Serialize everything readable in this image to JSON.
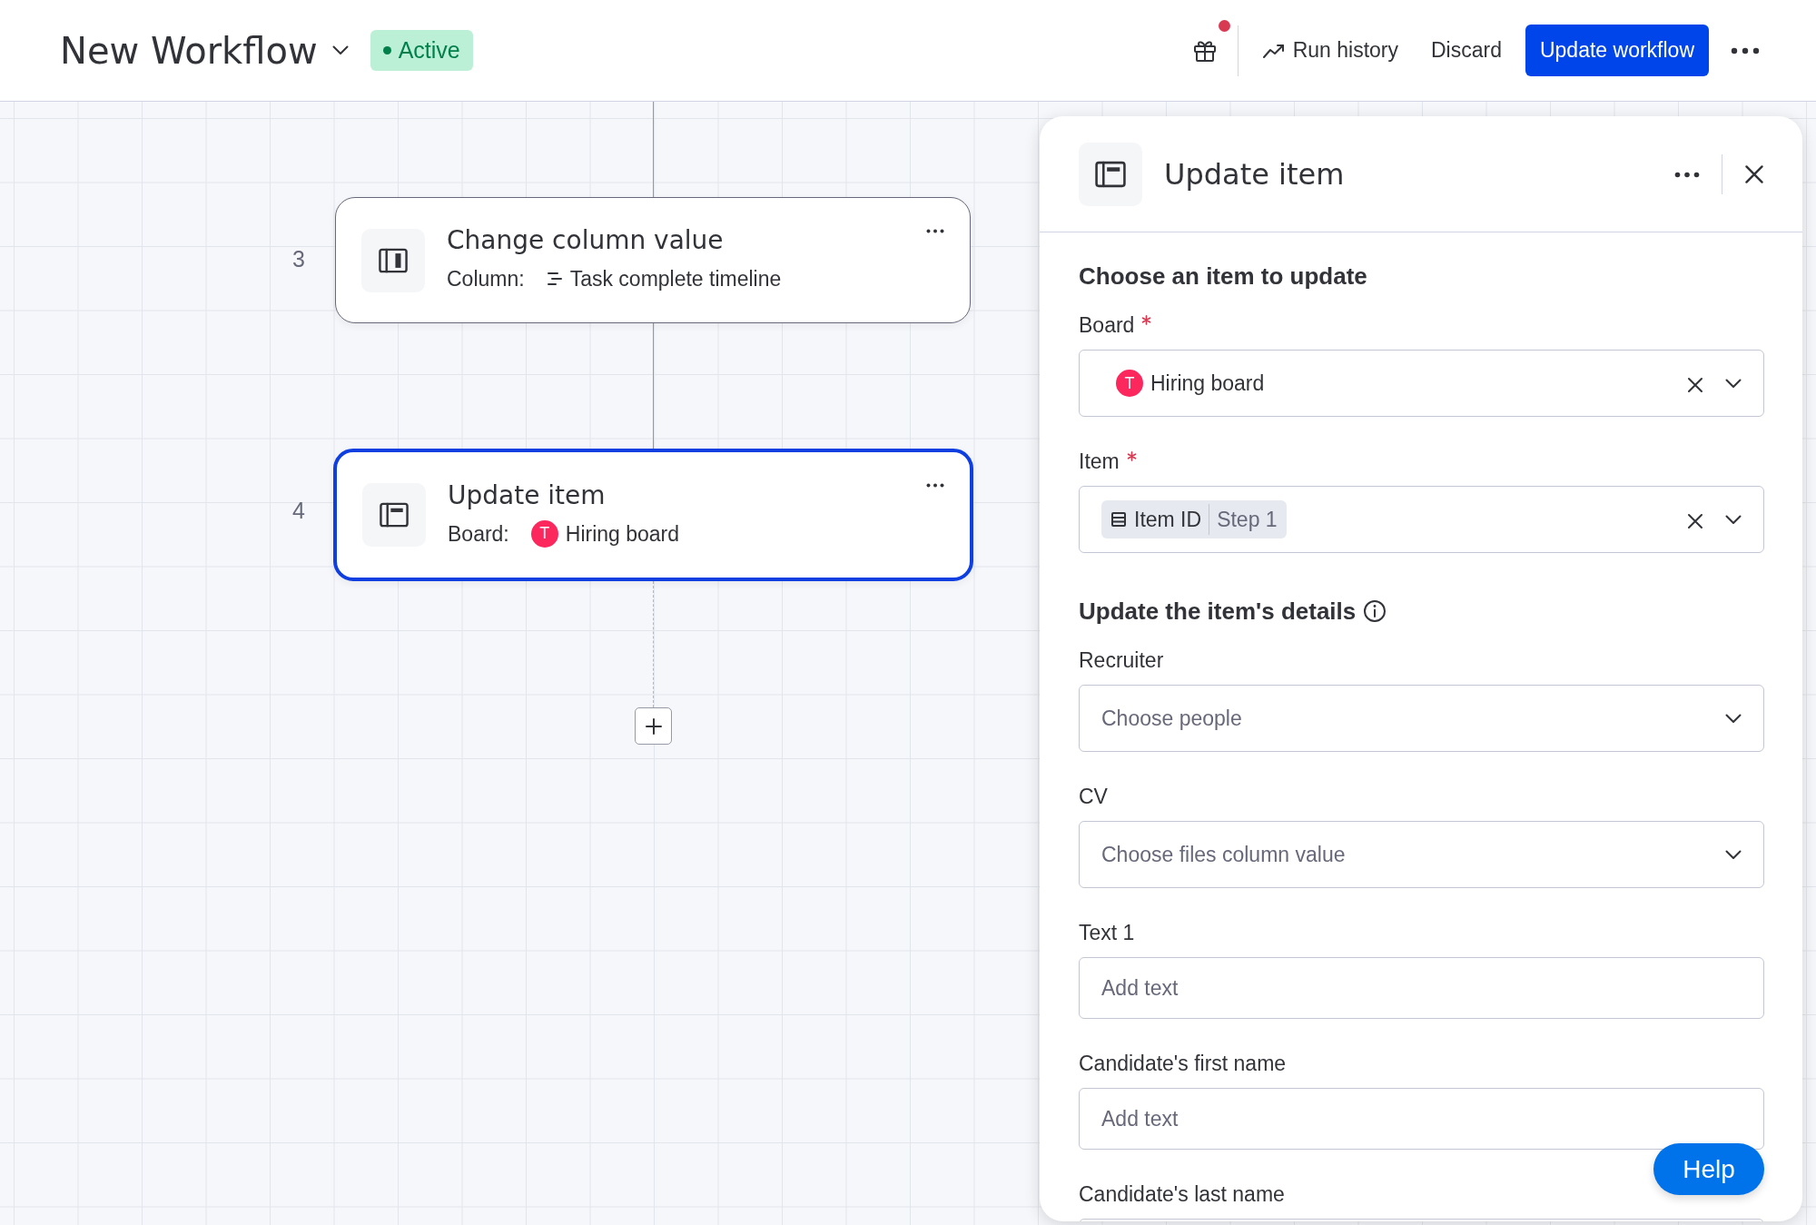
{
  "header": {
    "title": "New Workflow",
    "status": {
      "label": "Active",
      "active": true
    },
    "gift": {
      "has_notification": true
    },
    "actions": [
      {
        "kind": "history",
        "label": "Run history"
      },
      {
        "kind": "plain",
        "label": "Discard"
      }
    ],
    "primary_button": "Update workflow"
  },
  "canvas": {
    "steps": [
      {
        "number": "3",
        "kind": "change_column",
        "title": "Change column value",
        "detail_label": "Column:",
        "detail_value": "Task complete timeline",
        "selected": false
      },
      {
        "number": "4",
        "kind": "update_item",
        "title": "Update item",
        "detail_label": "Board:",
        "avatar": "T",
        "detail_value": "Hiring board",
        "selected": true
      }
    ]
  },
  "panel": {
    "title": "Update item",
    "sections": [
      {
        "heading": "Choose an item to update",
        "info": false,
        "fields": [
          {
            "kind": "board_select",
            "label": "Board",
            "required": true,
            "avatar": "T",
            "value": "Hiring board"
          },
          {
            "kind": "token_select",
            "label": "Item",
            "required": true,
            "token": "Item ID",
            "token_source": "Step 1"
          }
        ]
      },
      {
        "heading": "Update the item's details",
        "info": true,
        "fields": [
          {
            "kind": "select",
            "label": "Recruiter",
            "required": false,
            "placeholder": "Choose people"
          },
          {
            "kind": "select",
            "label": "CV",
            "required": false,
            "placeholder": "Choose files column value"
          },
          {
            "kind": "text",
            "label": "Text 1",
            "required": false,
            "placeholder": "Add text"
          },
          {
            "kind": "text",
            "label": "Candidate's first name",
            "required": false,
            "placeholder": "Add text"
          },
          {
            "kind": "text",
            "label": "Candidate's last name",
            "required": false
          }
        ]
      }
    ]
  },
  "help_button": "Help"
}
